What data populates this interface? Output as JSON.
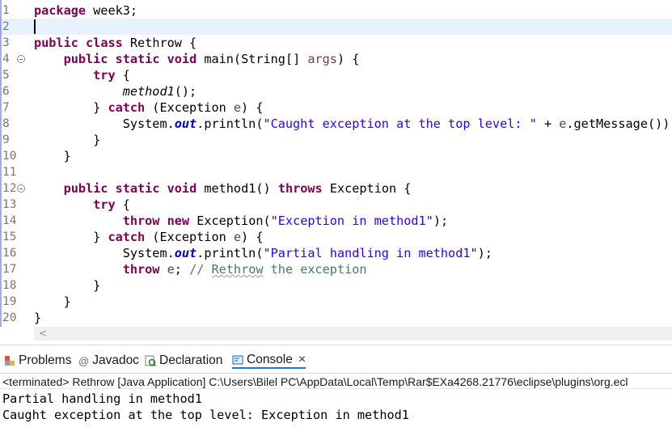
{
  "editor": {
    "lines": [
      {
        "n": "1",
        "fold": false,
        "segs": [
          [
            "kw",
            "package"
          ],
          [
            "",
            "&nbsp;week3;"
          ]
        ]
      },
      {
        "n": "2",
        "fold": false,
        "segs": []
      },
      {
        "n": "3",
        "fold": false,
        "segs": [
          [
            "kw",
            "public"
          ],
          [
            "",
            " "
          ],
          [
            "kw",
            "class"
          ],
          [
            "",
            " Rethrow {"
          ]
        ]
      },
      {
        "n": "4",
        "fold": true,
        "segs": [
          [
            "",
            "    "
          ],
          [
            "kw",
            "public"
          ],
          [
            "",
            " "
          ],
          [
            "kw",
            "static"
          ],
          [
            "",
            " "
          ],
          [
            "kw",
            "void"
          ],
          [
            "",
            " main(String[] "
          ],
          [
            "param",
            "args"
          ],
          [
            "",
            ") {"
          ]
        ]
      },
      {
        "n": "5",
        "fold": false,
        "segs": [
          [
            "",
            "        "
          ],
          [
            "kw",
            "try"
          ],
          [
            "",
            " {"
          ]
        ]
      },
      {
        "n": "6",
        "fold": false,
        "segs": [
          [
            "",
            "            "
          ],
          [
            "ital",
            "method1"
          ],
          [
            "",
            "();"
          ]
        ]
      },
      {
        "n": "7",
        "fold": false,
        "segs": [
          [
            "",
            "        } "
          ],
          [
            "kw",
            "catch"
          ],
          [
            "",
            " (Exception "
          ],
          [
            "param",
            "e"
          ],
          [
            "",
            ") {"
          ]
        ]
      },
      {
        "n": "8",
        "fold": false,
        "segs": [
          [
            "",
            "            System."
          ],
          [
            "fld",
            "out"
          ],
          [
            "",
            ".println("
          ],
          [
            "str",
            "\"Caught exception at the top level: \""
          ],
          [
            "",
            " + "
          ],
          [
            "param",
            "e"
          ],
          [
            "",
            ".getMessage());"
          ]
        ]
      },
      {
        "n": "9",
        "fold": false,
        "segs": [
          [
            "",
            "        }"
          ]
        ]
      },
      {
        "n": "10",
        "fold": false,
        "segs": [
          [
            "",
            "    }"
          ]
        ]
      },
      {
        "n": "11",
        "fold": false,
        "segs": []
      },
      {
        "n": "12",
        "fold": true,
        "segs": [
          [
            "",
            "    "
          ],
          [
            "kw",
            "public"
          ],
          [
            "",
            " "
          ],
          [
            "kw",
            "static"
          ],
          [
            "",
            " "
          ],
          [
            "kw",
            "void"
          ],
          [
            "",
            " method1() "
          ],
          [
            "kw",
            "throws"
          ],
          [
            "",
            " Exception {"
          ]
        ]
      },
      {
        "n": "13",
        "fold": false,
        "segs": [
          [
            "",
            "        "
          ],
          [
            "kw",
            "try"
          ],
          [
            "",
            " {"
          ]
        ]
      },
      {
        "n": "14",
        "fold": false,
        "segs": [
          [
            "",
            "            "
          ],
          [
            "kw",
            "throw"
          ],
          [
            "",
            " "
          ],
          [
            "kw",
            "new"
          ],
          [
            "",
            " Exception("
          ],
          [
            "str",
            "\"Exception in method1\""
          ],
          [
            "",
            ");"
          ]
        ]
      },
      {
        "n": "15",
        "fold": false,
        "segs": [
          [
            "",
            "        } "
          ],
          [
            "kw",
            "catch"
          ],
          [
            "",
            " (Exception "
          ],
          [
            "param",
            "e"
          ],
          [
            "",
            ") {"
          ]
        ]
      },
      {
        "n": "16",
        "fold": false,
        "segs": [
          [
            "",
            "            System."
          ],
          [
            "fld",
            "out"
          ],
          [
            "",
            ".println("
          ],
          [
            "str",
            "\"Partial handling in method1\""
          ],
          [
            "",
            ");"
          ]
        ]
      },
      {
        "n": "17",
        "fold": false,
        "segs": [
          [
            "",
            "            "
          ],
          [
            "kw",
            "throw"
          ],
          [
            "",
            " "
          ],
          [
            "param",
            "e"
          ],
          [
            "",
            "; "
          ],
          [
            "cmt",
            "// "
          ],
          [
            "cmt spell",
            "Rethrow"
          ],
          [
            "cmt",
            " the exception"
          ]
        ]
      },
      {
        "n": "18",
        "fold": false,
        "segs": [
          [
            "",
            "        }"
          ]
        ]
      },
      {
        "n": "19",
        "fold": false,
        "segs": [
          [
            "",
            "    }"
          ]
        ]
      },
      {
        "n": "20",
        "fold": false,
        "segs": [
          [
            "",
            "}"
          ]
        ]
      }
    ]
  },
  "scroll_arrow": "<",
  "panel": {
    "tabs": {
      "problems": "Problems",
      "javadoc": "Javadoc",
      "declaration": "Declaration",
      "console": "Console",
      "close": "×",
      "javadoc_icon": "@"
    },
    "terminated": "<terminated> Rethrow [Java Application] C:\\Users\\Bilel PC\\AppData\\Local\\Temp\\Rar$EXa4268.21776\\eclipse\\plugins\\org.ecl",
    "output": [
      "Partial handling in method1",
      "Caught exception at the top level: Exception in method1"
    ]
  },
  "icons": {
    "problems": "problems-icon",
    "javadoc": "javadoc-icon",
    "declaration": "declaration-icon",
    "console": "console-icon"
  }
}
